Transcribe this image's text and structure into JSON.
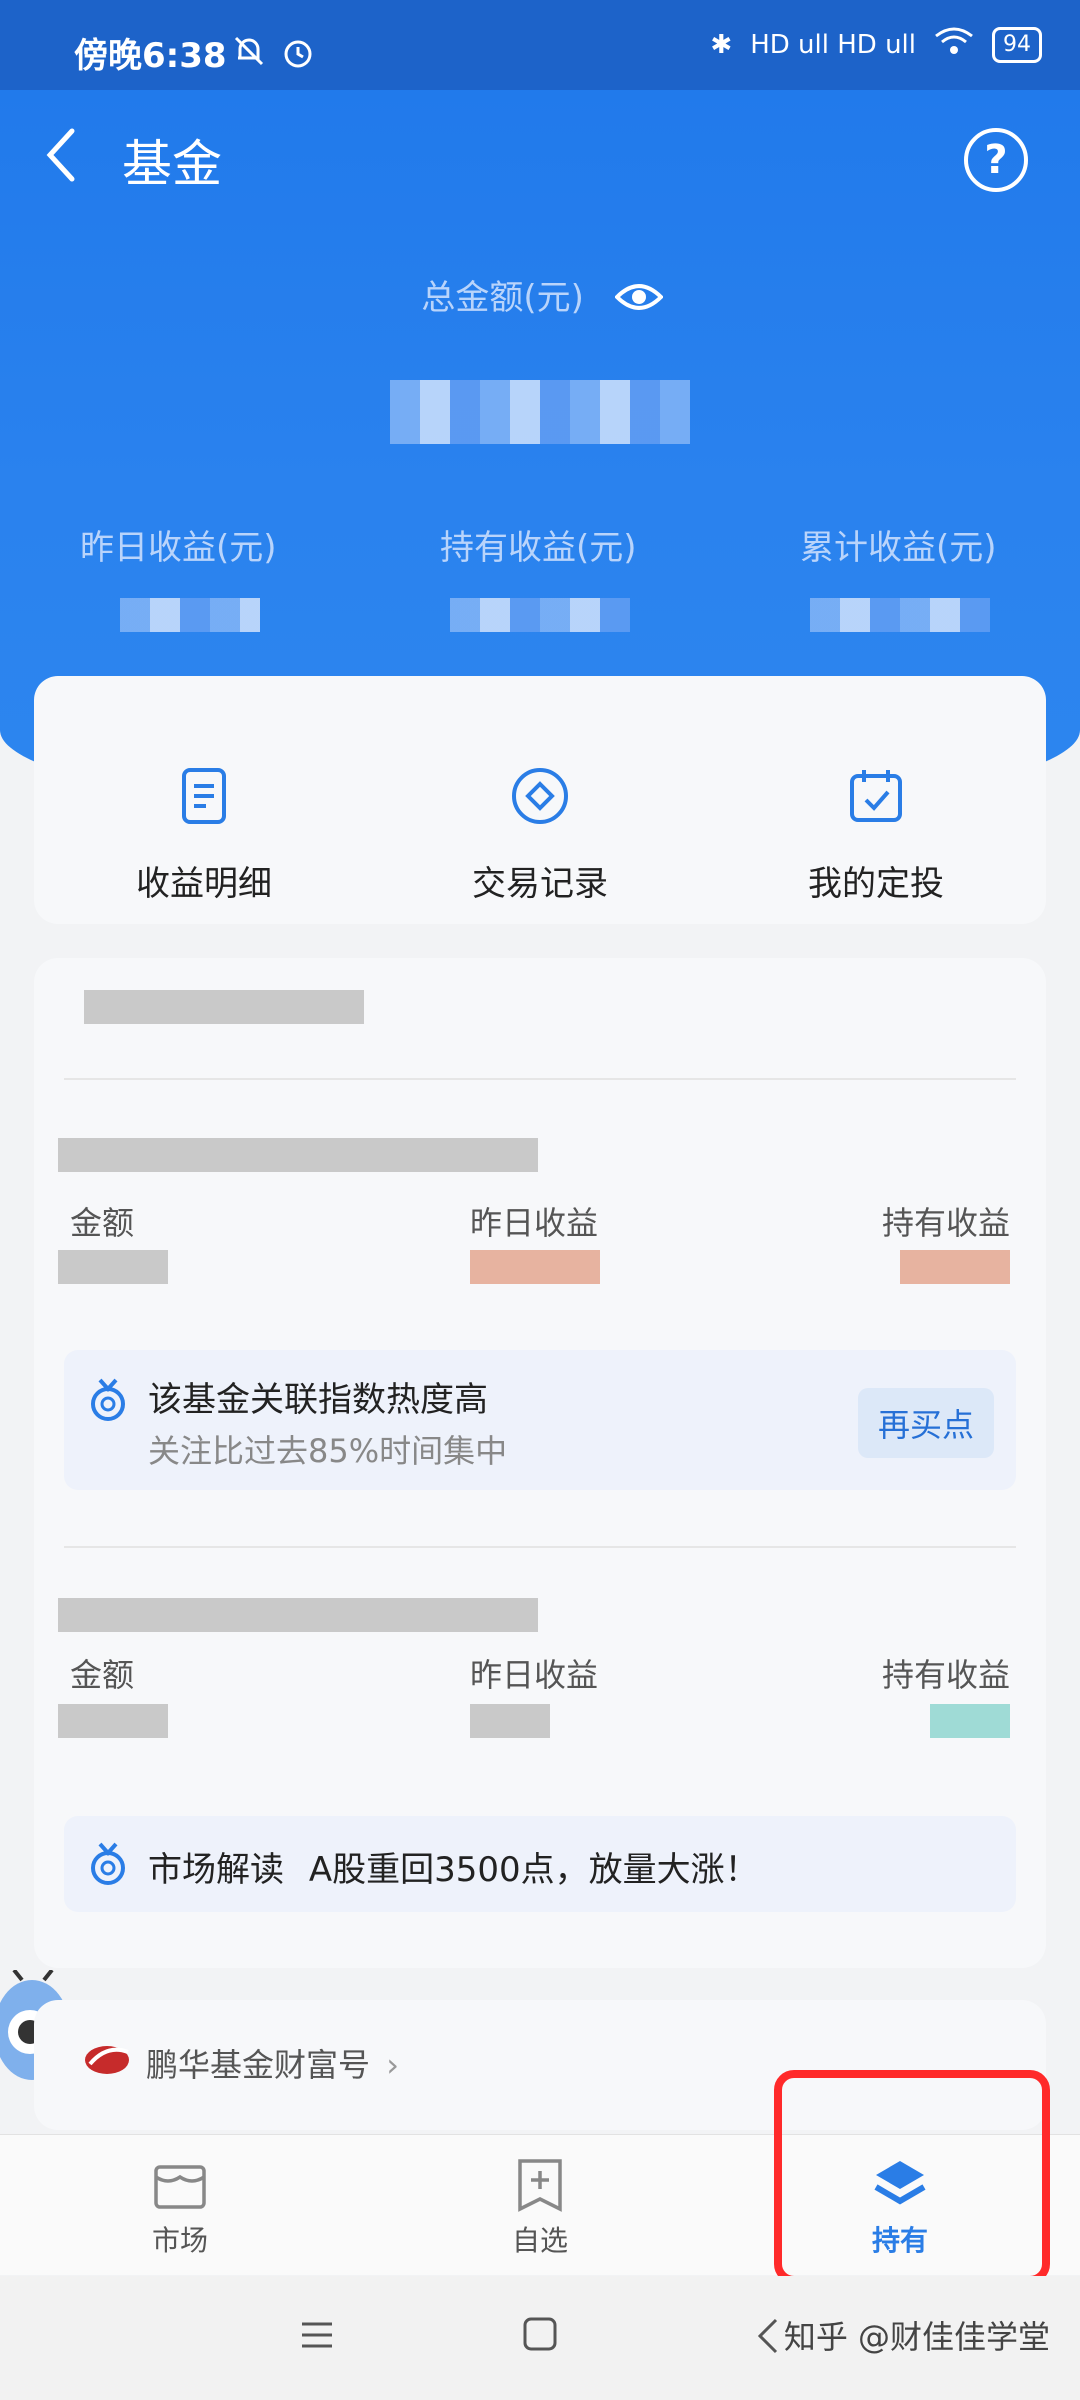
{
  "status_bar": {
    "time": "傍晚6:38",
    "network": "HD ull HD ull",
    "battery": "94"
  },
  "header": {
    "title": "基金",
    "help_symbol": "?",
    "total_label": "总金额(元)"
  },
  "stats": {
    "yesterday_label": "昨日收益(元)",
    "holding_label": "持有收益(元)",
    "cumulative_label": "累计收益(元)"
  },
  "quick_actions": [
    {
      "label": "收益明细",
      "icon": "document-icon"
    },
    {
      "label": "交易记录",
      "icon": "diamond-circle-icon"
    },
    {
      "label": "我的定投",
      "icon": "calendar-check-icon"
    }
  ],
  "holdings": {
    "fund1": {
      "amount_label": "金额",
      "yesterday_label": "昨日收益",
      "holding_label": "持有收益",
      "tip_title": "该基金关联指数热度高",
      "tip_sub": "关注比过去85%时间集中",
      "tip_button": "再买点"
    },
    "fund2": {
      "amount_label": "金额",
      "yesterday_label": "昨日收益",
      "holding_label": "持有收益",
      "tip_title": "市场解读",
      "tip_text": "A股重回3500点，放量大涨！"
    }
  },
  "wealth": {
    "label": "鹏华基金财富号",
    "chevron": "›"
  },
  "tabs": [
    {
      "label": "市场",
      "icon": "market-icon",
      "active": false
    },
    {
      "label": "自选",
      "icon": "add-favorite-icon",
      "active": false
    },
    {
      "label": "持有",
      "icon": "layers-icon",
      "active": true
    }
  ],
  "watermark": "知乎 @财佳佳学堂",
  "colors": {
    "primary": "#2a82ee",
    "highlight": "#ff2a2a"
  }
}
